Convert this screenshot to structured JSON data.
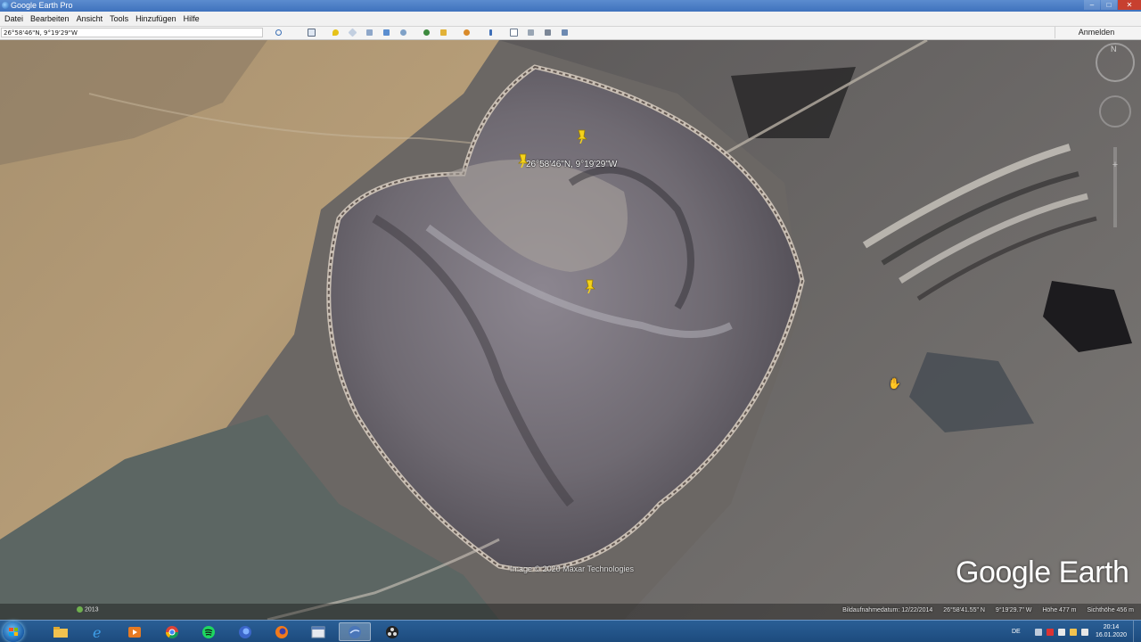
{
  "window": {
    "title": "Google Earth Pro",
    "buttons": [
      "–",
      "□",
      "✕"
    ]
  },
  "menu": [
    "Datei",
    "Bearbeiten",
    "Ansicht",
    "Tools",
    "Hinzufügen",
    "Hilfe"
  ],
  "toolbar": {
    "search_value": "26°58'46\"N, 9°19'29\"W",
    "login_label": "Anmelden",
    "icons": [
      "search-icon",
      "sidebar-icon",
      "placemark-icon",
      "polygon-icon",
      "path-icon",
      "overlay-icon",
      "tour-icon",
      "planets-icon",
      "sun-icon",
      "historical-imagery-icon",
      "ruler-icon",
      "email-icon",
      "print-icon",
      "save-image-icon",
      "maps-icon"
    ]
  },
  "map": {
    "placemark_label": "26°58'46\"N, 9°19'29\"W",
    "copyright": "Image © 2020 Maxar Technologies",
    "brand": "Google Earth",
    "compass_n": "N"
  },
  "status": {
    "year": "2013",
    "imagery_date": "Bildaufnahmedatum: 12/22/2014",
    "lat": "26°58'41.55\" N",
    "lon": "9°19'29.7\" W",
    "elevation": "Höhe  477 m",
    "eye_alt": "Sichthöhe  456 m"
  },
  "taskbar": {
    "apps": [
      "explorer",
      "internet-explorer",
      "media-player",
      "chrome",
      "spotify",
      "firefox-blue",
      "firefox",
      "app-window",
      "google-earth",
      "obs"
    ],
    "lang": "DE",
    "time": "20:14",
    "date": "16.01.2020"
  },
  "colors": {
    "pin": "#f4d21b",
    "taskbar": "#1f4f85",
    "titlebar": "#4a7dc4"
  }
}
